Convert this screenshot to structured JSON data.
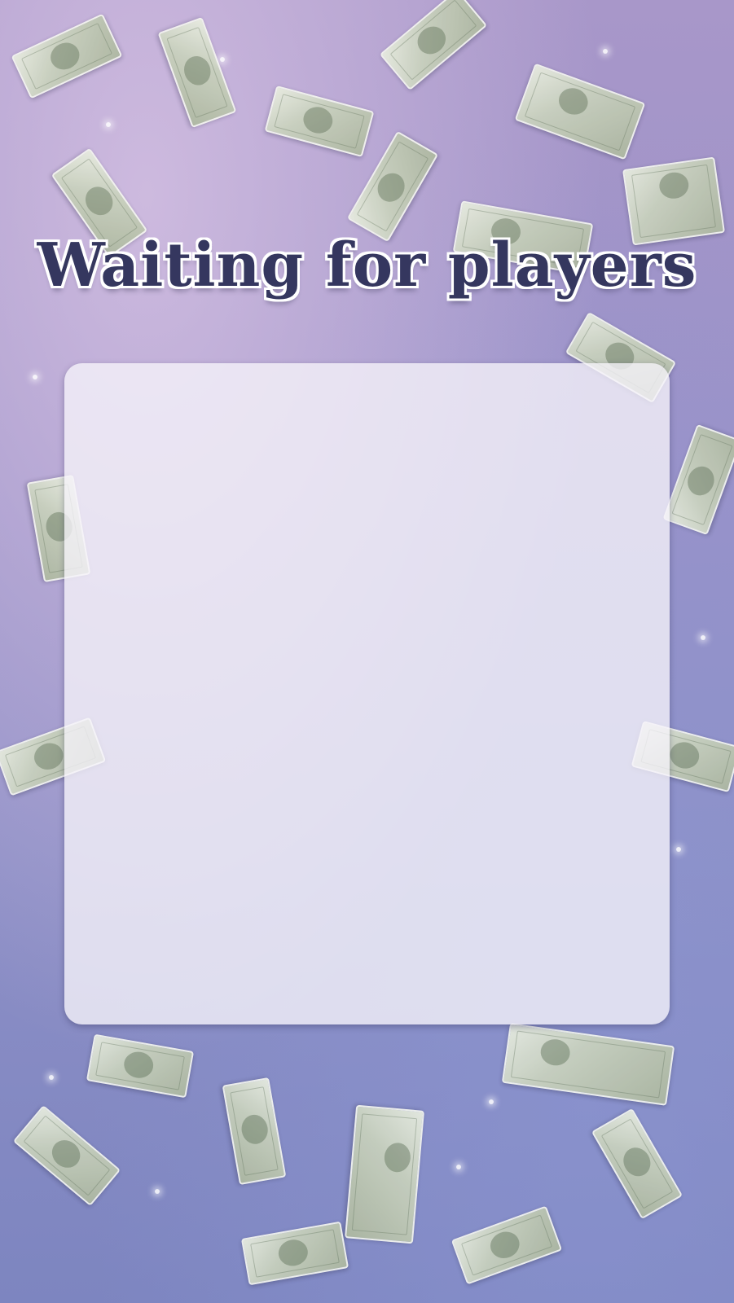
{
  "screen": {
    "title": "Waiting for players",
    "background": "falling-money-background",
    "colors": {
      "title_fill": "#35375f",
      "title_outline": "#ffffff",
      "panel": "#f6f4fa"
    }
  },
  "lobby_panel": {
    "players": []
  }
}
